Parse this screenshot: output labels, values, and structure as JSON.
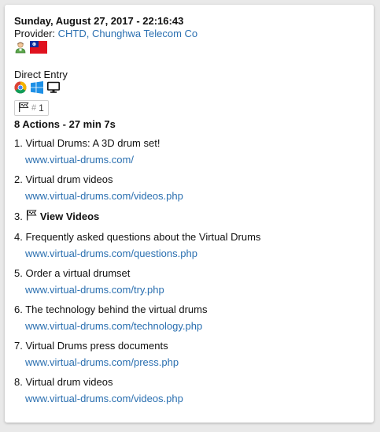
{
  "visit": {
    "datetime": "Sunday, August 27, 2017 - 22:16:43",
    "provider_label": "Provider:",
    "provider_name": "CHTD, Chunghwa Telecom Co",
    "visitor_icon": "visitor-profile-icon",
    "country_flag": "taiwan-flag-icon",
    "referrer": "Direct Entry",
    "browser_icon": "chrome-icon",
    "os_icon": "windows-icon",
    "device_icon": "desktop-icon",
    "visit_badge_hash": "#",
    "visit_badge_number": "1",
    "summary": "8 Actions - 27 min 7s"
  },
  "actions": [
    {
      "num": "1.",
      "title": "Virtual Drums: A 3D drum set!",
      "url": "www.virtual-drums.com/"
    },
    {
      "num": "2.",
      "title": "Virtual drum videos",
      "url": "www.virtual-drums.com/videos.php"
    },
    {
      "num": "3.",
      "title": "View Videos",
      "url": "",
      "is_event": true
    },
    {
      "num": "4.",
      "title": "Frequently asked questions about the Virtual Drums",
      "url": "www.virtual-drums.com/questions.php"
    },
    {
      "num": "5.",
      "title": "Order a virtual drumset",
      "url": "www.virtual-drums.com/try.php"
    },
    {
      "num": "6.",
      "title": "The technology behind the virtual drums",
      "url": "www.virtual-drums.com/technology.php"
    },
    {
      "num": "7.",
      "title": "Virtual Drums press documents",
      "url": "www.virtual-drums.com/press.php"
    },
    {
      "num": "8.",
      "title": "Virtual drum videos",
      "url": "www.virtual-drums.com/videos.php"
    }
  ],
  "colors": {
    "link": "#2a6fb0"
  }
}
